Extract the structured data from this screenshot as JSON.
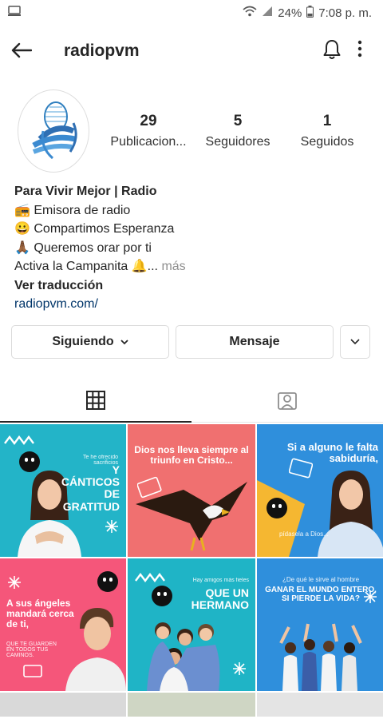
{
  "status": {
    "battery": "24%",
    "time": "7:08 p. m."
  },
  "appbar": {
    "username": "radiopvm"
  },
  "profile": {
    "posts": {
      "count": "29",
      "label": "Publicacion..."
    },
    "followers": {
      "count": "5",
      "label": "Seguidores"
    },
    "following": {
      "count": "1",
      "label": "Seguidos"
    }
  },
  "bio": {
    "name": "Para Vivir Mejor | Radio",
    "line1": "📻 Emisora de radio",
    "line2": "😀 Compartimos Esperanza",
    "line3": "🙏🏾 Queremos orar por ti",
    "line4": "Activa la Campanita 🔔...",
    "more": "más",
    "translate": "Ver traducción",
    "link": "radiopvm.com/"
  },
  "actions": {
    "following": "Siguiendo",
    "message": "Mensaje"
  },
  "posts": [
    {
      "bg": "#23b4c8",
      "main": "Y CÁNTICOS DE GRATITUD",
      "sub": "Te he ofrecido sacrificios"
    },
    {
      "bg": "#f07070",
      "main": "Dios nos lleva siempre al triunfo en Cristo...",
      "sub": ""
    },
    {
      "bg": "#2f8fdc",
      "main": "Si a alguno le falta sabiduría,",
      "sub": "pídasela a Dios..."
    },
    {
      "bg": "#f5567a",
      "main": "A sus ángeles mandará cerca de ti,",
      "sub": "QUE TE GUARDEN EN TODOS TUS CAMINOS."
    },
    {
      "bg": "#1fb4c6",
      "main": "QUE UN HERMANO",
      "sub": "Hay amigos más fieles"
    },
    {
      "bg": "#2f8fdc",
      "main": "GANAR EL MUNDO ENTERO, SI PIERDE LA VIDA?",
      "sub": "¿De qué le sirve al hombre"
    }
  ]
}
